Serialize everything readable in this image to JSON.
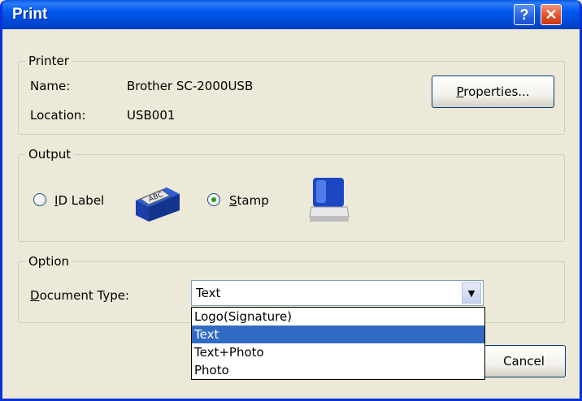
{
  "window": {
    "title": "Print"
  },
  "titlebar": {
    "help_glyph": "?",
    "close_glyph": "✕"
  },
  "printer": {
    "legend": "Printer",
    "name_label": "Name:",
    "name_value": "Brother SC-2000USB",
    "location_label": "Location:",
    "location_value": "USB001",
    "properties_accel": "P",
    "properties_rest": "roperties..."
  },
  "output": {
    "legend": "Output",
    "id_label_accel": "I",
    "id_label_rest": "D Label",
    "stamp_accel": "S",
    "stamp_rest": "tamp",
    "selected": "Stamp"
  },
  "option": {
    "legend": "Option",
    "doc_type_accel": "D",
    "doc_type_rest": "ocument Type:",
    "selected_value": "Text",
    "options": [
      "Logo(Signature)",
      "Text",
      "Text+Photo",
      "Photo"
    ],
    "highlighted_index": 1
  },
  "buttons": {
    "cancel_label": "Cancel"
  },
  "colors": {
    "titlebar": "#0058ee",
    "highlight": "#316ac5",
    "face": "#ece9d8"
  },
  "icons": [
    "help-icon",
    "close-icon",
    "id-label-tape-icon",
    "stamp-icon",
    "dropdown-arrow-icon"
  ]
}
